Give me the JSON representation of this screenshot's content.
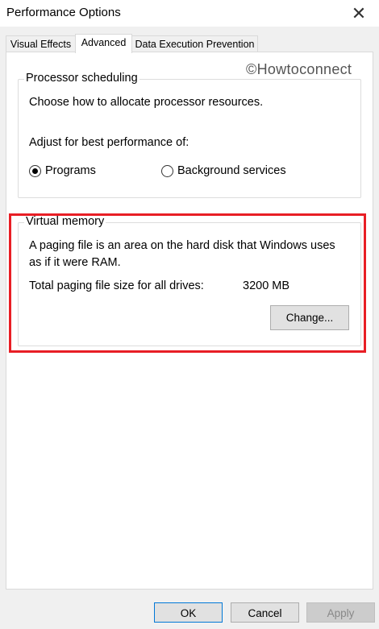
{
  "window": {
    "title": "Performance Options",
    "close_glyph": "✕"
  },
  "tabs": [
    {
      "label": "Visual Effects"
    },
    {
      "label": "Advanced"
    },
    {
      "label": "Data Execution Prevention"
    }
  ],
  "watermark": "©Howtoconnect",
  "processor_scheduling": {
    "legend": "Processor scheduling",
    "description": "Choose how to allocate processor resources.",
    "adjust_label": "Adjust for best performance of:",
    "options": [
      {
        "label": "Programs",
        "selected": true
      },
      {
        "label": "Background services",
        "selected": false
      }
    ]
  },
  "virtual_memory": {
    "legend": "Virtual memory",
    "description_line1": "A paging file is an area on the hard disk that Windows uses",
    "description_line2": "as if it were RAM.",
    "total_label": "Total paging file size for all drives:",
    "total_value": "3200 MB",
    "change_button": "Change..."
  },
  "footer": {
    "ok": "OK",
    "cancel": "Cancel",
    "apply": "Apply"
  },
  "colors": {
    "highlight": "#e81e25",
    "accent": "#0078d7"
  }
}
